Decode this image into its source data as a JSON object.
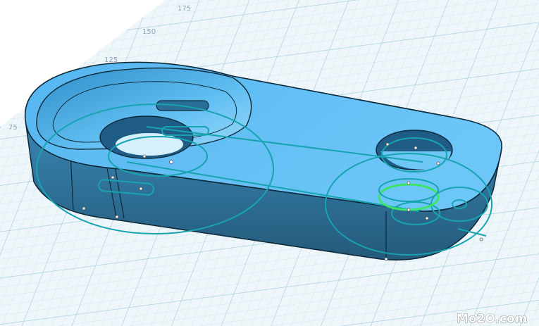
{
  "viewport": {
    "grid_labels": [
      "175",
      "150",
      "125",
      "75"
    ]
  },
  "model": {
    "body_color": "#3aa8e6",
    "top_color": "#5ec1f6",
    "side_color": "#2e6f94",
    "sketch_color": "#17a3b0",
    "selected_color": "#3ee36a"
  },
  "watermark": {
    "text": "Mo2O.com"
  }
}
